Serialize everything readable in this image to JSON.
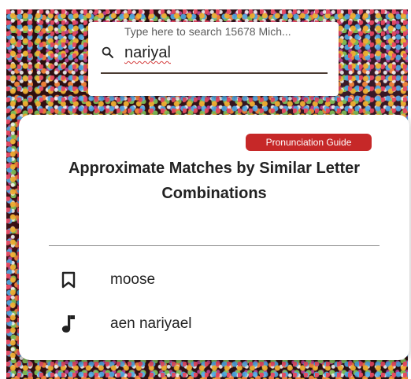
{
  "search": {
    "placeholder": "Type here to search 15678 Mich...",
    "query": "nariyal"
  },
  "results": {
    "badge_label": "Pronunciation Guide",
    "title": "Approximate Matches by Similar Letter Combinations",
    "items": [
      {
        "label": "moose",
        "icon": "bookmark-icon"
      },
      {
        "label": "aen nariyael",
        "icon": "music-note-icon"
      }
    ]
  },
  "colors": {
    "badge": "#c62828",
    "background": "#2a0f0f"
  }
}
